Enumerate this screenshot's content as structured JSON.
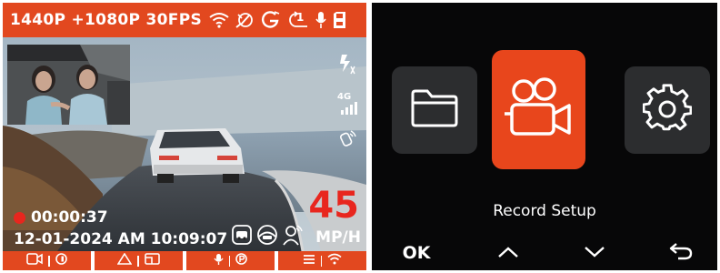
{
  "colors": {
    "accent": "#e2481f",
    "recording": "#e8261e",
    "tile": "#2c2d2f",
    "menu_bg": "#070708"
  },
  "live_view": {
    "mode_text": "1440P +1080P 30FPS",
    "status_icons": [
      "wifi-icon",
      "satellite-icon",
      "gps-icon",
      "loop-recording-icon",
      "microphone-icon",
      "sd-card-icon"
    ],
    "side_icons": [
      "sos-emergency-icon",
      "cellular-4g-icon",
      "voice-control-icon"
    ],
    "signal_label": "4G",
    "loop_label": "1",
    "recording_time": "00:00:37",
    "datetime": "12-01-2024 AM 10:09:07",
    "speed_value": "45",
    "speed_unit": "MP/H",
    "bottom_buttons": [
      {
        "left_icon": "video-camera-icon",
        "right_icon": "stop-circle-icon"
      },
      {
        "left_icon": "triangle-icon",
        "right_icon": "photo-frame-icon"
      },
      {
        "left_icon": "microphone-icon",
        "right_icon": "parking-mode-icon"
      },
      {
        "left_icon": "menu-icon",
        "right_icon": "wifi-icon"
      }
    ]
  },
  "menu": {
    "tiles": [
      {
        "icon": "folder-icon",
        "selected": false
      },
      {
        "icon": "movie-camera-icon",
        "selected": true
      },
      {
        "icon": "gear-icon",
        "selected": false
      }
    ],
    "selected_label": "Record Setup",
    "nav": {
      "ok": "OK",
      "up_icon": "chevron-up-icon",
      "down_icon": "chevron-down-icon",
      "back_icon": "return-arrow-icon"
    }
  }
}
